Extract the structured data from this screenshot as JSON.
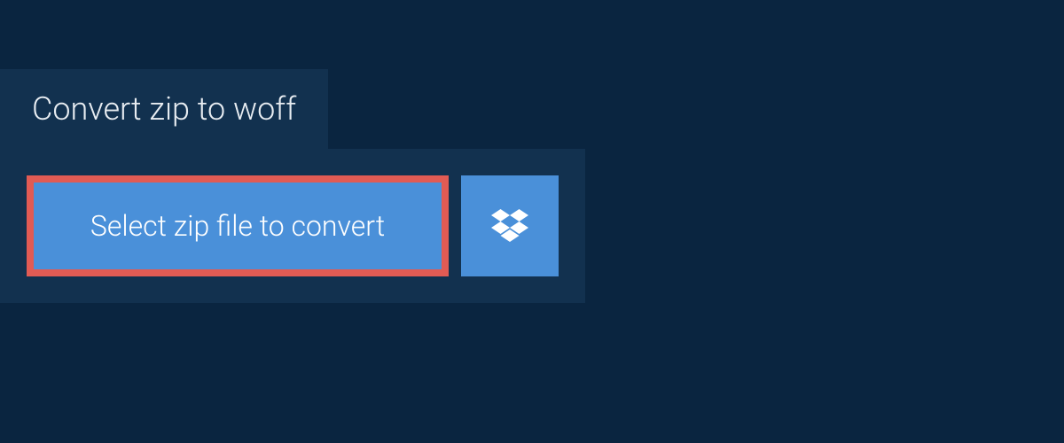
{
  "tab": {
    "title": "Convert zip to woff"
  },
  "actions": {
    "select_file_label": "Select zip file to convert"
  },
  "colors": {
    "page_bg": "#0a2540",
    "panel_bg": "#12314f",
    "button_bg": "#4a90d9",
    "highlight_border": "#e15b54",
    "text_light": "#e8edf2"
  }
}
